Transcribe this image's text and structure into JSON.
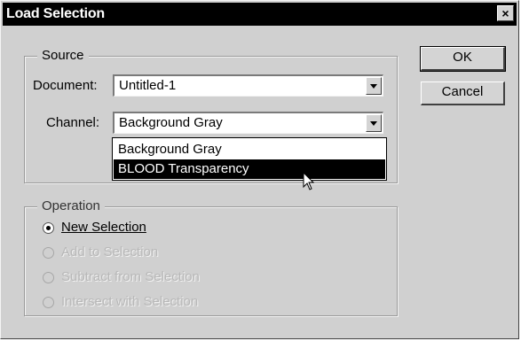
{
  "window": {
    "title": "Load Selection",
    "close_glyph": "×"
  },
  "source": {
    "legend": "Source",
    "document_label": "Document:",
    "document_value": "Untitled-1",
    "channel_label": "Channel:",
    "channel_value": "Background Gray",
    "channel_options": [
      "Background Gray",
      "BLOOD Transparency"
    ],
    "highlighted_option": "BLOOD Transparency"
  },
  "buttons": {
    "ok": "OK",
    "cancel": "Cancel"
  },
  "operation": {
    "legend": "Operation",
    "options": [
      {
        "label": "New Selection",
        "checked": true,
        "enabled": true
      },
      {
        "label": "Add to Selection",
        "checked": false,
        "enabled": false
      },
      {
        "label": "Subtract from Selection",
        "checked": false,
        "enabled": false
      },
      {
        "label": "Intersect with Selection",
        "checked": false,
        "enabled": false
      }
    ]
  },
  "icons": {
    "dropdown_arrow": "chevron-down-icon",
    "cursor": "pointer-cursor-icon"
  },
  "colors": {
    "title_bar": "#000000",
    "dialog_face": "#d0d0d0",
    "selected_item": "#000000"
  }
}
